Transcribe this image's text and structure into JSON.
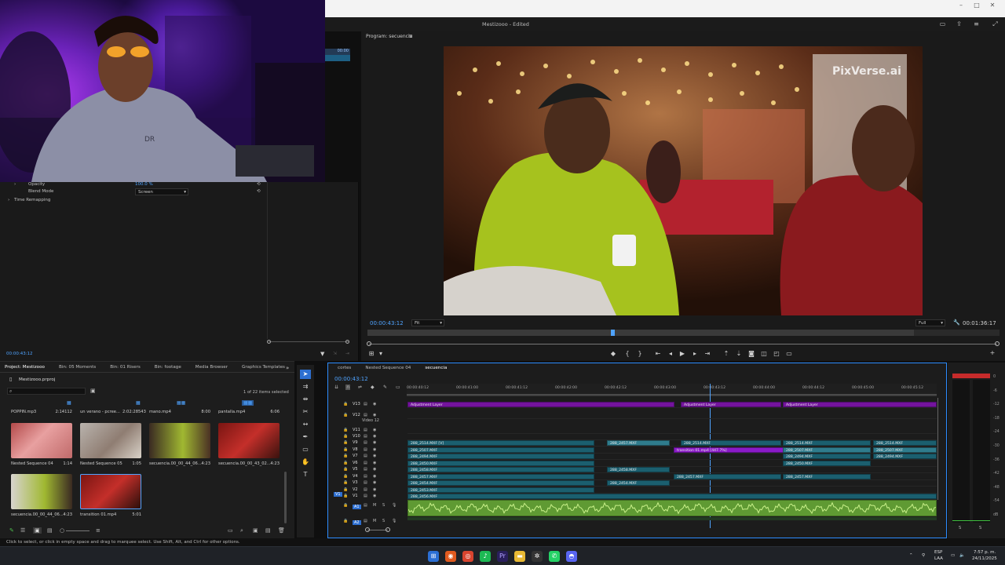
{
  "window": {
    "title": "Mestizooo - Edited"
  },
  "effect_controls": {
    "header_time": "00:00",
    "opacity_label": "Opacity",
    "opacity_value": "100.0 %",
    "blend_mode_label": "Blend Mode",
    "blend_mode_value": "Screen",
    "time_remapping_label": "Time Remapping",
    "timecode": "00:00:43:12"
  },
  "program_monitor": {
    "title": "Program: secuencia",
    "timecode": "00:00:43:12",
    "zoom": "Fit",
    "quality": "Full",
    "duration": "00:01:36:17",
    "watermark": "PixVerse.ai"
  },
  "project_panel": {
    "tabs": [
      "Project: Mestizooo",
      "Bin: 05 Moments",
      "Bin: 01 Risers",
      "Bin: footage",
      "Media Browser",
      "Graphics Templates"
    ],
    "project_file": "Mestizooo.prproj",
    "items_selected": "1 of 22 items selected",
    "top_row": [
      {
        "name": "POPPIN.mp3",
        "duration": "2:14112"
      },
      {
        "name": "un verano - pcree...",
        "duration": "2:02:28543"
      },
      {
        "name": "mano.mp4",
        "duration": "8:00"
      },
      {
        "name": "pantalla.mp4",
        "duration": "6:06"
      }
    ],
    "clips": [
      {
        "name": "Nested Sequence 04",
        "duration": "1:14"
      },
      {
        "name": "Nested Sequence 05",
        "duration": "1:05"
      },
      {
        "name": "secuencia.00_00_44_06...",
        "duration": "4:23"
      },
      {
        "name": "secuencia.00_00_43_02...",
        "duration": "4:23"
      },
      {
        "name": "secuencia.00_00_44_06...",
        "duration": "4:23"
      },
      {
        "name": "transition 01.mp4",
        "duration": "5:01"
      }
    ]
  },
  "timeline": {
    "tabs": [
      "cortes",
      "Nested Sequence 04",
      "secuencia"
    ],
    "timecode": "00:00:43:12",
    "ruler": [
      "00:00:40:12",
      "00:00:41:00",
      "00:00:41:12",
      "00:00:42:00",
      "00:00:42:12",
      "00:00:43:00",
      "00:00:43:12",
      "00:00:44:00",
      "00:00:44:12",
      "00:00:45:00",
      "00:00:45:12"
    ],
    "video_tracks": [
      "V13",
      "V12",
      "V11",
      "V10",
      "V9",
      "V8",
      "V7",
      "V6",
      "V5",
      "V4",
      "V3",
      "V2",
      "V1"
    ],
    "video12_label": "Video 12",
    "audio_tracks": [
      "A1",
      "A2"
    ],
    "source_patch": "V1",
    "adjustment_layer": "Adjustment Layer",
    "clip_names": {
      "c2514v": "288_2514.MXF [V]",
      "c2457": "288_2457.MXF",
      "c2514": "288_2514.MXF",
      "c2507": "288_2507.MXF",
      "c2494": "288_2494.MXF",
      "c2450": "288_2450.MXF",
      "c2458": "288_2458.MXF",
      "c2454": "288_2454.MXF",
      "c2453": "288_2453.MXF",
      "c2456": "288_2456.MXF",
      "transition": "transition 01.mp4 [447.7%]"
    }
  },
  "audio_meter": {
    "scale": [
      "0",
      "-6",
      "-12",
      "-18",
      "-24",
      "-30",
      "-36",
      "-42",
      "-48",
      "-54",
      "dB"
    ],
    "channels": [
      "S",
      "S"
    ]
  },
  "status_bar": "Click to select, or click in empty space and drag to marquee select. Use Shift, Alt, and Ctrl for other options.",
  "taskbar": {
    "language": "ESP",
    "layout": "LAA",
    "time": "7:57 p. m.",
    "date": "24/11/2025"
  },
  "colors": {
    "accent": "#2d8cff",
    "timecode": "#4fa3ff",
    "teal_clip": "#1b5f6f",
    "adjustment_clip": "#74149e",
    "audio_clip": "#6fa83a"
  }
}
